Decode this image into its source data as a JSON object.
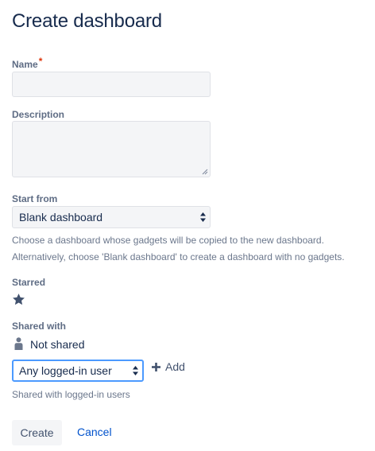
{
  "page": {
    "title": "Create dashboard"
  },
  "form": {
    "name": {
      "label": "Name",
      "required_marker": "*",
      "value": ""
    },
    "description": {
      "label": "Description",
      "value": ""
    },
    "start_from": {
      "label": "Start from",
      "selected": "Blank dashboard",
      "help_line1": "Choose a dashboard whose gadgets will be copied to the new dashboard.",
      "help_line2": "Alternatively, choose 'Blank dashboard' to create a dashboard with no gadgets."
    },
    "starred": {
      "label": "Starred",
      "icon": "star-icon"
    },
    "shared_with": {
      "label": "Shared with",
      "current": "Not shared",
      "current_icon": "person-icon",
      "selected": "Any logged-in user",
      "add_label": "Add",
      "add_icon": "plus-icon",
      "help": "Shared with logged-in users"
    }
  },
  "actions": {
    "create_label": "Create",
    "cancel_label": "Cancel"
  },
  "colors": {
    "heading": "#172b4d",
    "label": "#5e6c84",
    "link": "#0052cc",
    "focus": "#4c9aff",
    "required": "#de350b"
  }
}
